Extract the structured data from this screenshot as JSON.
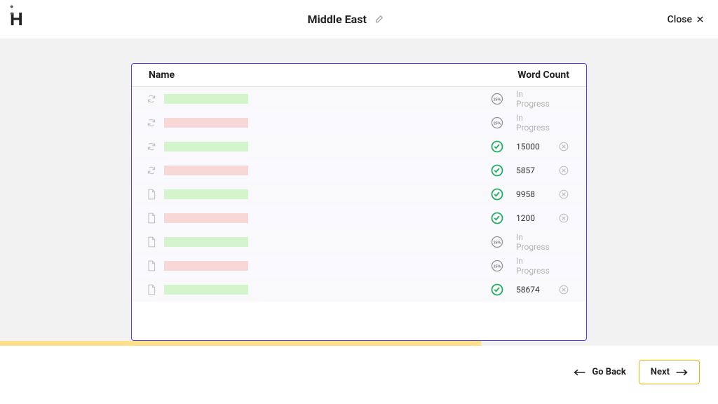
{
  "header": {
    "logo_text": "H",
    "title": "Middle East",
    "close_label": "Close"
  },
  "table": {
    "col_name": "Name",
    "col_wordcount": "Word Count",
    "rows": [
      {
        "file_icon": "refresh",
        "bar_color": "green",
        "status": "pending",
        "pending_label": "25%",
        "word_count": "In Progress",
        "deletable": false
      },
      {
        "file_icon": "refresh",
        "bar_color": "red",
        "status": "pending",
        "pending_label": "25%",
        "word_count": "In Progress",
        "deletable": false
      },
      {
        "file_icon": "refresh",
        "bar_color": "green",
        "status": "done",
        "pending_label": "",
        "word_count": "15000",
        "deletable": true
      },
      {
        "file_icon": "refresh",
        "bar_color": "red",
        "status": "done",
        "pending_label": "",
        "word_count": "5857",
        "deletable": true
      },
      {
        "file_icon": "document",
        "bar_color": "green",
        "status": "done",
        "pending_label": "",
        "word_count": "9958",
        "deletable": true
      },
      {
        "file_icon": "document",
        "bar_color": "red",
        "status": "done",
        "pending_label": "",
        "word_count": "1200",
        "deletable": true
      },
      {
        "file_icon": "document",
        "bar_color": "green",
        "status": "pending",
        "pending_label": "25%",
        "word_count": "In Progress",
        "deletable": false
      },
      {
        "file_icon": "document",
        "bar_color": "red",
        "status": "pending",
        "pending_label": "25%",
        "word_count": "In Progress",
        "deletable": false
      },
      {
        "file_icon": "document",
        "bar_color": "green",
        "status": "done",
        "pending_label": "",
        "word_count": "58674",
        "deletable": true
      }
    ]
  },
  "progress": {
    "percent": 67
  },
  "footer": {
    "back_label": "Go Back",
    "next_label": "Next"
  },
  "colors": {
    "panel_border": "#4f3ee0",
    "accent": "#f0b400",
    "status_done": "#27ae60",
    "bar_green": "#d4f4ce",
    "bar_red": "#f8d7d7"
  }
}
